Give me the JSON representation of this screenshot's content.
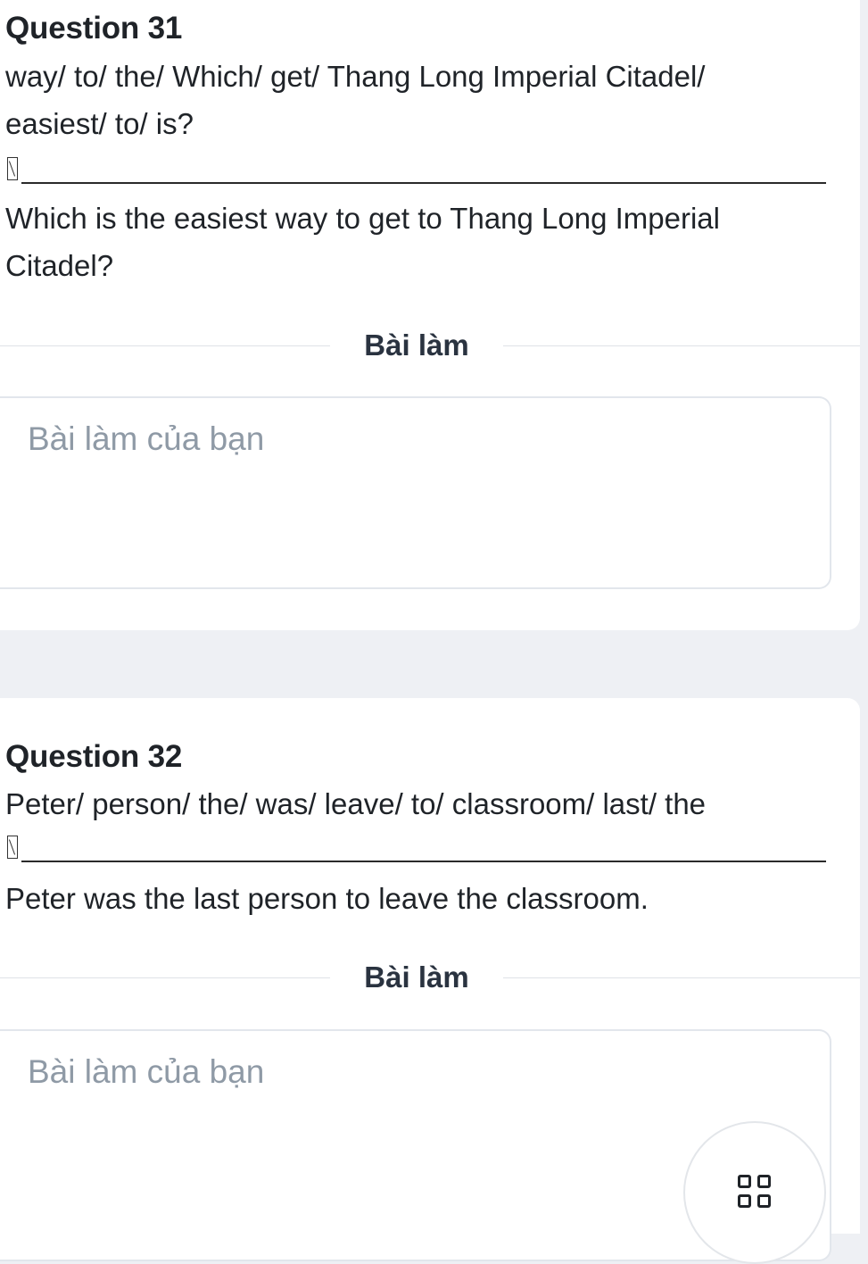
{
  "questions": [
    {
      "title": "Question 31",
      "prompt_line1": "way/ to/ the/ Which/ get/ Thang Long Imperial Citadel/",
      "prompt_line2": "easiest/ to/ is?",
      "answer_line1": "Which is the easiest way to get to Thang Long Imperial",
      "answer_line2": "Citadel?",
      "section_label": "Bài làm",
      "answer_placeholder": "Bài làm của bạn"
    },
    {
      "title": "Question 32",
      "prompt_line1": "Peter/ person/ the/ was/ leave/ to/ classroom/ last/ the",
      "answer_line1": "Peter was the last person to leave the classroom.",
      "section_label": "Bài làm",
      "answer_placeholder": "Bài làm của bạn"
    }
  ],
  "floating_button": {
    "icon": "grid-icon"
  },
  "colors": {
    "page_background": "#eef0f4",
    "card_background": "#ffffff",
    "placeholder_text": "#8f9aa6",
    "text": "#1f2328"
  }
}
